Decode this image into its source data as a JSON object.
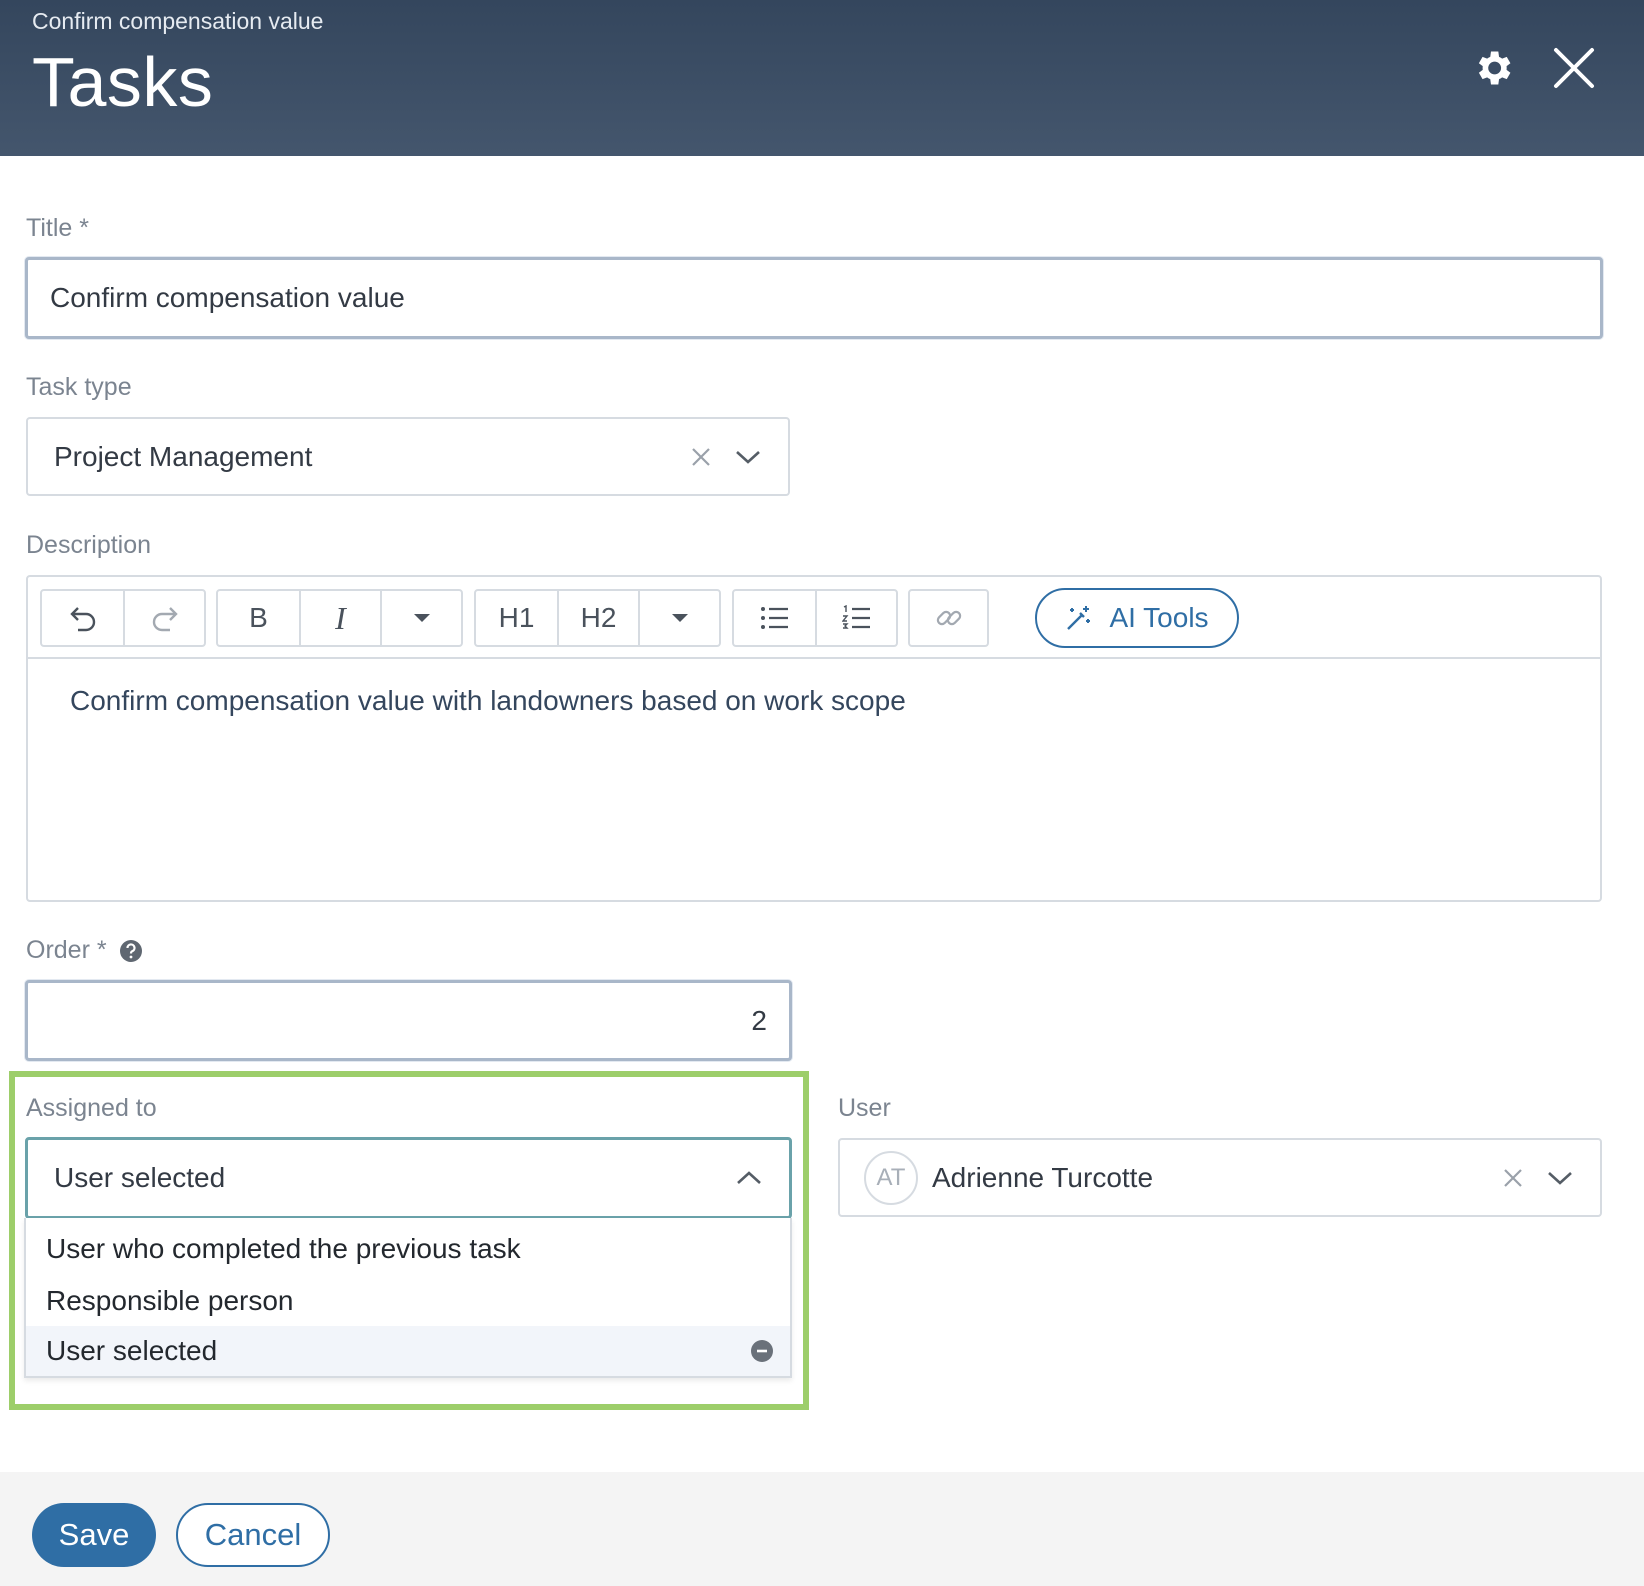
{
  "header": {
    "breadcrumb": "Confirm compensation value",
    "title": "Tasks",
    "settings_icon": "gear-icon",
    "close_icon": "close-icon"
  },
  "form": {
    "title_field": {
      "label": "Title *",
      "value": "Confirm compensation value"
    },
    "task_type": {
      "label": "Task type",
      "value": "Project Management"
    },
    "description": {
      "label": "Description",
      "toolbar": {
        "undo_icon": "undo-icon",
        "redo_icon": "redo-icon",
        "bold": "B",
        "italic": "I",
        "h1": "H1",
        "h2": "H2",
        "bullet_list_icon": "bullet-list-icon",
        "numbered_list_icon": "numbered-list-icon",
        "link_icon": "link-icon",
        "ai_tools": "AI Tools"
      },
      "content": "Confirm compensation value with landowners based on work scope"
    },
    "order": {
      "label": "Order *",
      "value": "2",
      "help_icon": "help-icon"
    },
    "assigned_to": {
      "label": "Assigned to",
      "value": "User selected",
      "options": [
        "User who completed the previous task",
        "Responsible person",
        "User selected"
      ],
      "selected_index": 2
    },
    "user": {
      "label": "User",
      "avatar_initials": "AT",
      "value": "Adrienne Turcotte"
    }
  },
  "footer": {
    "save": "Save",
    "cancel": "Cancel"
  },
  "colors": {
    "header_bg": "#3a4c63",
    "primary": "#2f6ea5",
    "highlight": "#9dce6a",
    "footer_bg": "#f4f4f4"
  }
}
